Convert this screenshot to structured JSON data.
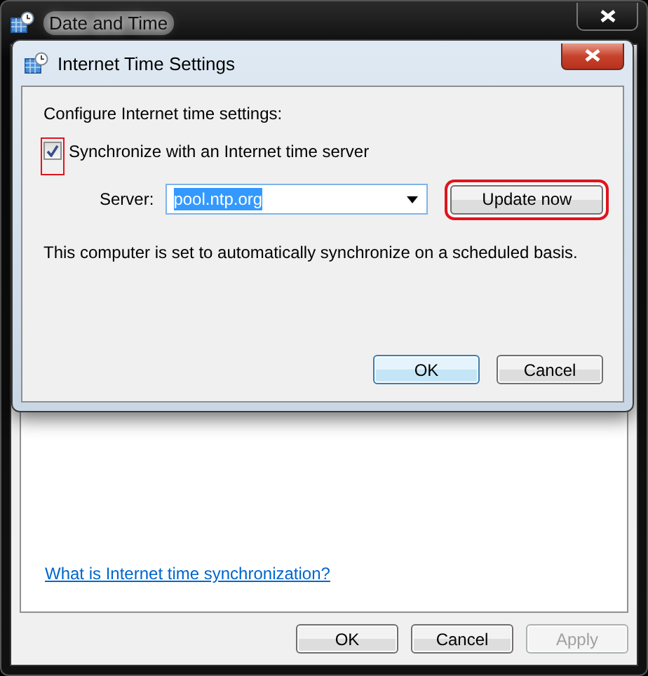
{
  "window": {
    "title": "Date and Time",
    "link": "What is Internet time synchronization?",
    "buttons": [
      {
        "label": "OK",
        "disabled": false
      },
      {
        "label": "Cancel",
        "disabled": false
      },
      {
        "label": "Apply",
        "disabled": true
      }
    ]
  },
  "dialog": {
    "title": "Internet Time Settings",
    "heading": "Configure Internet time settings:",
    "sync": {
      "label": "Synchronize with an Internet time server",
      "checked": true,
      "highlighted": true
    },
    "server": {
      "label": "Server:",
      "value": "pool.ntp.org"
    },
    "update": {
      "label": "Update now",
      "highlighted": true
    },
    "status": "This computer is set to automatically synchronize on a scheduled basis.",
    "buttons": [
      {
        "label": "OK",
        "default": true
      },
      {
        "label": "Cancel",
        "default": false
      }
    ]
  }
}
